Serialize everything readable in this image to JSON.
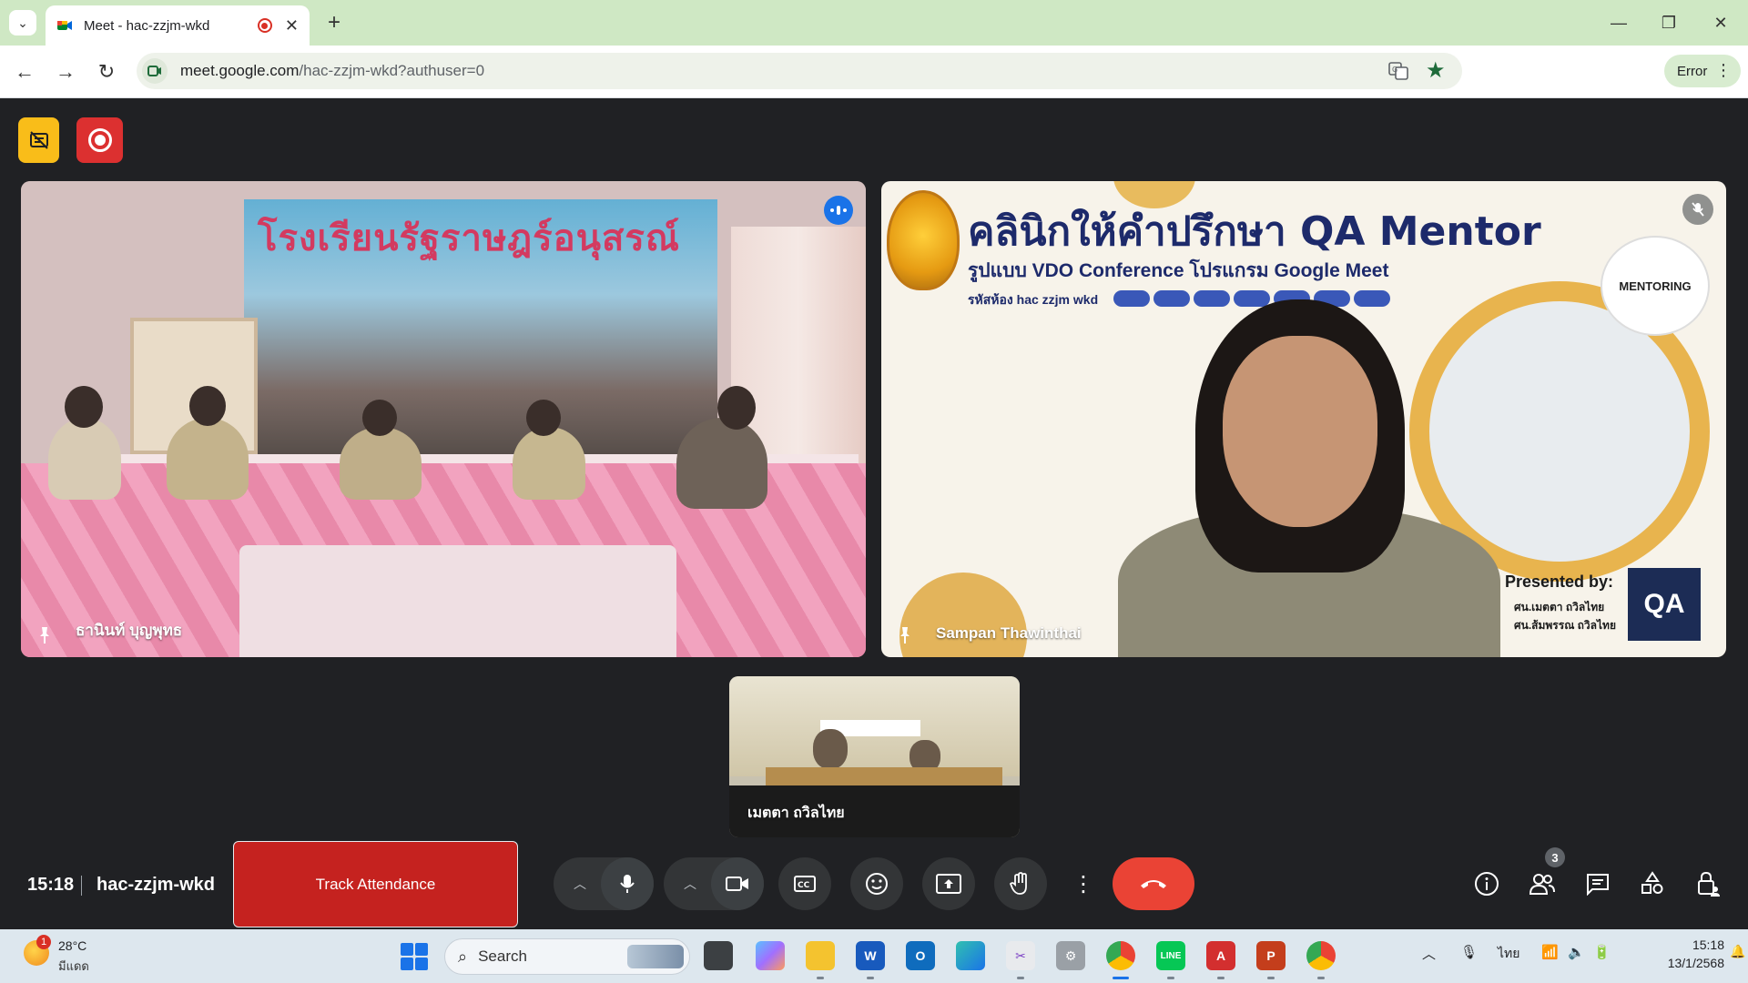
{
  "browser": {
    "tab_title": "Meet - hac-zzjm-wkd",
    "url_host": "meet.google.com",
    "url_path": "/hac-zzjm-wkd?authuser=0",
    "profile_status": "Error"
  },
  "tiles": [
    {
      "name": "ธานินท์ บุญพุทธ",
      "banner_text": "โรงเรียนรัฐราษฎร์อนุสรณ์"
    },
    {
      "name": "Sampan Thawinthai",
      "title": "คลินิกให้คำปรึกษา QA Mentor",
      "subtitle": "รูปแบบ VDO Conference โปรแกรม Google Meet",
      "room": "รหัสห้อง hac zzjm wkd",
      "mentoring": "MENTORING",
      "presented_by": "Presented by:",
      "presenters": [
        "ศน.เมตตา ถวิลไทย",
        "ศน.ส้มพรรณ ถวิลไทย"
      ],
      "qa_logo": "QA"
    },
    {
      "name": "เมตตา ถวิลไทย"
    }
  ],
  "meet_bar": {
    "time": "15:18",
    "meeting_code": "hac-zzjm-wkd",
    "track_attendance_label": "Track Attendance",
    "people_count": "3"
  },
  "taskbar": {
    "weather_temp": "28°C",
    "weather_condition": "มีแดด",
    "weather_badge": "1",
    "search_placeholder": "Search",
    "language": "ไทย",
    "time": "15:18",
    "date": "13/1/2568"
  },
  "colors": {
    "meet_bg": "#202124",
    "record_red": "#dc3030",
    "caption_yellow": "#f9bd19",
    "end_call_red": "#ea4335",
    "track_attendance_red": "#c5221f",
    "tabstrip_green": "#cfe8c4"
  }
}
